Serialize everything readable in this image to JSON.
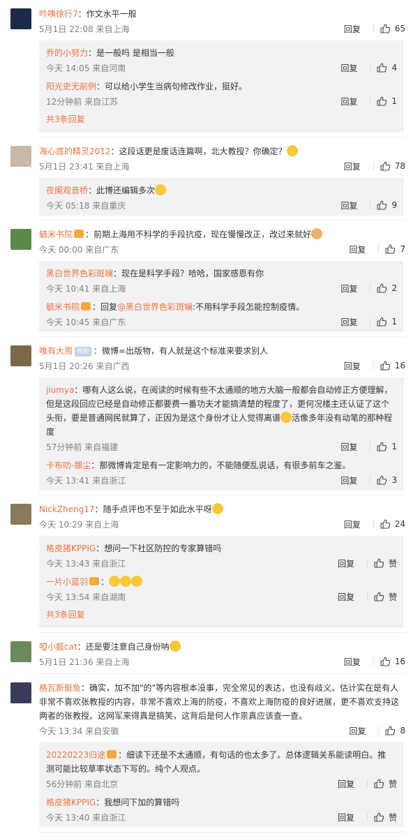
{
  "labels": {
    "reply": "回复",
    "like_zero": "赞",
    "show_more": "共3条回复"
  },
  "comments": [
    {
      "user": "吟咦徐行7",
      "text": "：作文水平一般",
      "time": "5月1日 22:08 来自上海",
      "likes": "65",
      "avatar_color": "#1c2a4a",
      "replies": [
        {
          "user": "乔的小努力",
          "text": "：是一般吗 是相当一般",
          "time": "今天 14:05 来自河南",
          "likes": "4"
        },
        {
          "user": "阳光史无前例",
          "text": "：可以给小学生当病句修改作业，挺好。",
          "time": "12分钟前 来自江苏",
          "likes": "1"
        }
      ],
      "more": "共3条回复"
    },
    {
      "user": "海心底的精灵2012",
      "text": "：这段话更是废话连篇啊，北大教授？你确定？",
      "time": "5月1日 23:41 来自上海",
      "likes": "78",
      "avatar_color": "#c8b8a8",
      "replies": [
        {
          "user": "夜阑观音桥",
          "text": "：此博还编辑多次",
          "time": "今天 05:18 来自重庆",
          "likes": "9"
        }
      ]
    },
    {
      "user": "毓米书院",
      "text": "：前期上海用不科学的手段抗疫，现在慢慢改正，改过来就好",
      "time": "今天 00:00 来自广东",
      "likes": "7",
      "avatar_color": "#5a8a4a",
      "replies": [
        {
          "user": "黑白世界色彩斑斓",
          "text": "：现在是科学手段？哈哈，国家感恩有你",
          "time": "今天 10:41 来自上海",
          "likes": "2"
        },
        {
          "user": "毓米书院",
          "text": "：回复",
          "mention": "@黑白世界色彩斑斓",
          "text2": ":不用科学手段怎能控制疫情。",
          "time": "今天 10:45 来自广东",
          "likes": "1"
        }
      ]
    },
    {
      "user": "唯有大周",
      "tag": "铁粉",
      "text": "：微博=出版物，有人就是这个标准来要求别人",
      "time": "5月1日 20:26 来自广西",
      "likes": "16",
      "avatar_color": "#7a6a4a",
      "replies": [
        {
          "user": "jiumya",
          "text": "：哪有人这么说，在阅读的时候有些不太通顺的地方大脑一般都会自动修正方便理解，但是这段回应已经是自动修正都要费一番功夫才能搞清楚的程度了，更何况楼主还认证了这个头衔，要是普通网民就算了，正因为是这个身份才让人觉得离谱",
          "text2": "活像多年没有动笔的那种程度",
          "time": "57分钟前 来自福建",
          "likes": "1"
        },
        {
          "user": "卡布叻-娜尘",
          "text": "：那微博肯定是有一定影响力的，不能随便乱说话，有很多前车之鉴。",
          "time": "今天 13:41 来自浙江",
          "likes": "3"
        }
      ]
    },
    {
      "user": "NickZheng17",
      "text": "：随手点评也不至于如此水平呀",
      "time": "今天 10:29 来自上海",
      "likes": "24",
      "avatar_color": "#8a7a5a",
      "replies": [
        {
          "user": "格皮猪KPPIG",
          "text": "：想问一下社区防控的专家算错吗",
          "time": "今天 13:43 来自浙江",
          "likes": "赞"
        },
        {
          "user": "一片小蓝羽",
          "text": "：",
          "time": "今天 13:54 来自湖南",
          "likes": "赞"
        }
      ],
      "more": "共3条回复"
    },
    {
      "user": "啞小懿cat",
      "text": "：还是要注意自己身份呐",
      "time": "5月1日 21:36 来自上海",
      "likes": "16",
      "avatar_color": "#6a8a5a",
      "replies": []
    },
    {
      "user": "格瓦斯艇鱼",
      "text": "：确实，加不加\"的\"等内容根本没事，完全常见的表达，也没有歧义。估计实在是有人非常不喜欢张教授的内容，非常不喜欢上海的防疫，不喜欢上海防疫的良好进展，更不喜欢支持这两者的张教授。这网军来得真是搞笑，这背后是何人作祟真应该查一查。",
      "time": "今天 13:34 来自安徽",
      "likes": "8",
      "avatar_color": "#3a3a5a",
      "replies": [
        {
          "user": "20220223归途",
          "text": "：细读下还是不太通顺，有句话的也太多了。总体逻辑关系能读明白。推测可能比较草率状态下写的。纯个人观点。",
          "time": "56分钟前 来自北京",
          "likes": "赞"
        },
        {
          "user": "格皮猪KPPIG",
          "text": "：我想问下加的算错吗",
          "time": "今天 13:40 来自浙江",
          "likes": "赞"
        }
      ]
    }
  ]
}
